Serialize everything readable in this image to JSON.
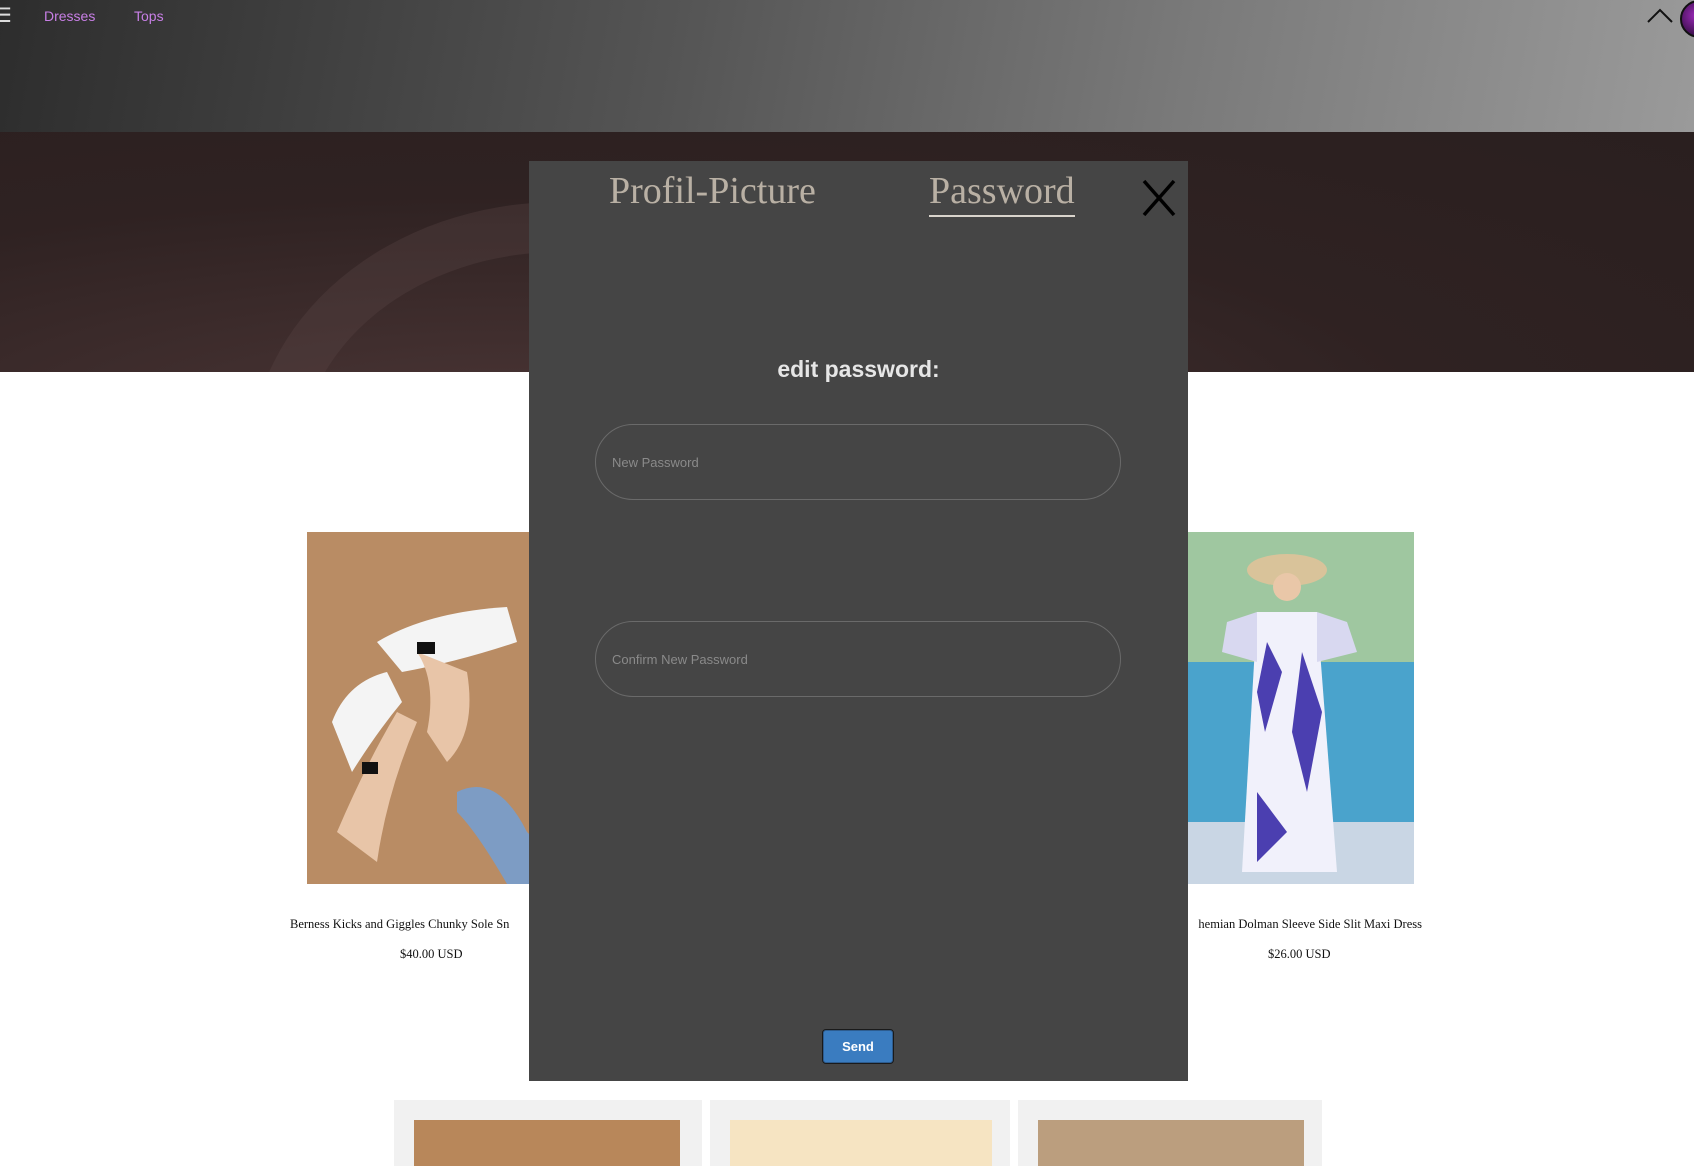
{
  "nav": {
    "items": [
      {
        "label": "Dresses"
      },
      {
        "label": "Tops"
      }
    ]
  },
  "modal": {
    "tabs": [
      {
        "label": "Profil-Picture"
      },
      {
        "label": "Password",
        "active": true
      }
    ],
    "heading": "edit password:",
    "new_password_placeholder": "New Password",
    "confirm_password_placeholder": "Confirm New Password",
    "send_label": "Send"
  },
  "products": [
    {
      "name": "Berness Kicks and Giggles Chunky Sole Sn",
      "price": "$40.00 USD"
    },
    {
      "name": "hemian Dolman Sleeve Side Slit Maxi Dress",
      "price": "$26.00 USD"
    }
  ],
  "colors": {
    "nav_link": "#c87fe6",
    "modal_bg": "#454545",
    "send_button": "#3a7cc0",
    "tab_text": "#b9b0a4"
  }
}
